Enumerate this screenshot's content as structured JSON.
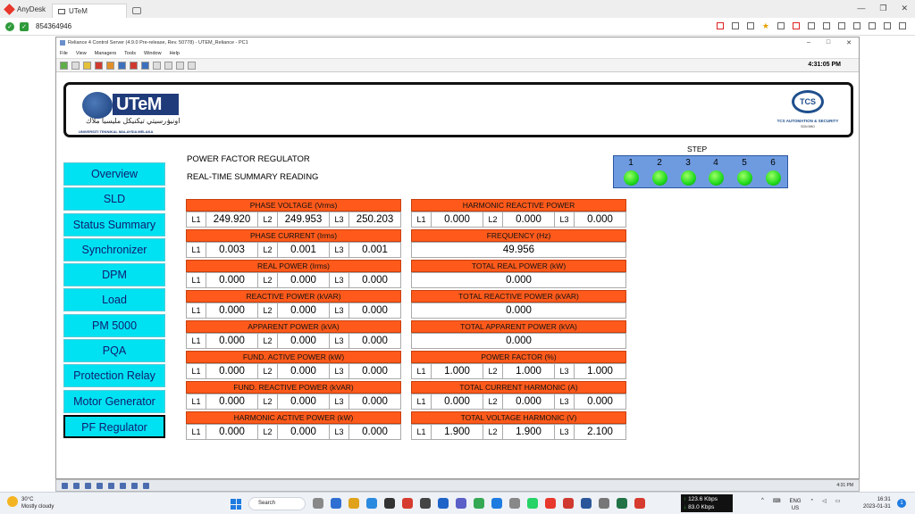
{
  "anydesk": {
    "brand": "AnyDesk",
    "tab_label": "UTeM",
    "remote_id": "854364946"
  },
  "window": {
    "title": "Reliance 4 Control Server (4.9.0 Pre-release, Rev. 50778) - UTEM_Reliance - PC1",
    "menu": [
      "File",
      "View",
      "Managers",
      "Tools",
      "Window",
      "Help"
    ],
    "clock": "4:31:05 PM"
  },
  "banner": {
    "utem_text": "UTeM",
    "utem_arabic": "اونيۏرسيتي تيكنيكل مليسيا ملاك",
    "utem_subtitle": "UNIVERSITI TEKNIKAL MALAYSIA MELAKA",
    "tcs_text": "TCS",
    "tcs_name": "TCS AUTOMATION & SECURITY",
    "tcs_sub": "SDN BHD"
  },
  "nav": [
    "Overview",
    "SLD",
    "Status Summary",
    "Synchronizer",
    "DPM",
    "Load",
    "PM 5000",
    "PQA",
    "Protection Relay",
    "Motor Generator",
    "PF Regulator"
  ],
  "page": {
    "title": "POWER FACTOR REGULATOR",
    "subtitle": "REAL-TIME SUMMARY READING"
  },
  "steps": {
    "label": "STEP",
    "numbers": [
      "1",
      "2",
      "3",
      "4",
      "5",
      "6"
    ],
    "led_color": "#1fd91c"
  },
  "colors": {
    "panel_header": "#ff5a1b",
    "nav_bg": "#00e2f2",
    "nav_text": "#101c6e",
    "step_box": "#6e9be0"
  },
  "left_panels": [
    {
      "title": "PHASE VOLTAGE (Vrms)",
      "labels": [
        "L1",
        "L2",
        "L3"
      ],
      "values": [
        "249.920",
        "249.953",
        "250.203"
      ]
    },
    {
      "title": "PHASE CURRENT (Irms)",
      "labels": [
        "L1",
        "L2",
        "L3"
      ],
      "values": [
        "0.003",
        "0.001",
        "0.001"
      ]
    },
    {
      "title": "REAL POWER (Irms)",
      "labels": [
        "L1",
        "L2",
        "L3"
      ],
      "values": [
        "0.000",
        "0.000",
        "0.000"
      ]
    },
    {
      "title": "REACTIVE POWER (kVAR)",
      "labels": [
        "L1",
        "L2",
        "L3"
      ],
      "values": [
        "0.000",
        "0.000",
        "0.000"
      ]
    },
    {
      "title": "APPARENT POWER (kVA)",
      "labels": [
        "L1",
        "L2",
        "L3"
      ],
      "values": [
        "0.000",
        "0.000",
        "0.000"
      ]
    },
    {
      "title": "FUND. ACTIVE POWER (kW)",
      "labels": [
        "L1",
        "L2",
        "L3"
      ],
      "values": [
        "0.000",
        "0.000",
        "0.000"
      ]
    },
    {
      "title": "FUND. REACTIVE POWER (kVAR)",
      "labels": [
        "L1",
        "L2",
        "L3"
      ],
      "values": [
        "0.000",
        "0.000",
        "0.000"
      ]
    },
    {
      "title": "HARMONIC ACTIVE POWER (kW)",
      "labels": [
        "L1",
        "L2",
        "L3"
      ],
      "values": [
        "0.000",
        "0.000",
        "0.000"
      ]
    }
  ],
  "right_panels": [
    {
      "title": "HARMONIC REACTIVE POWER",
      "labels": [
        "L1",
        "L2",
        "L3"
      ],
      "values": [
        "0.000",
        "0.000",
        "0.000"
      ]
    },
    {
      "title": "FREQUENCY (Hz)",
      "value": "49.956"
    },
    {
      "title": "TOTAL REAL POWER (kW)",
      "value": "0.000"
    },
    {
      "title": "TOTAL REACTIVE POWER (kVAR)",
      "value": "0.000"
    },
    {
      "title": "TOTAL APPARENT POWER (kVA)",
      "value": "0.000"
    },
    {
      "title": "POWER FACTOR (%)",
      "labels": [
        "L1",
        "L2",
        "L3"
      ],
      "values": [
        "1.000",
        "1.000",
        "1.000"
      ]
    },
    {
      "title": "TOTAL CURRENT HARMONIC (A)",
      "labels": [
        "L1",
        "L2",
        "L3"
      ],
      "values": [
        "0.000",
        "0.000",
        "0.000"
      ]
    },
    {
      "title": "TOTAL VOLTAGE HARMONIC (V)",
      "labels": [
        "L1",
        "L2",
        "L3"
      ],
      "values": [
        "1.900",
        "1.900",
        "2.100"
      ]
    }
  ],
  "remote_tray": {
    "time": "4:31 PM"
  },
  "taskbar": {
    "weather_temp": "30°C",
    "weather_desc": "Mostly cloudy",
    "search": "Search",
    "net_up": "123.6 Kbps",
    "net_down": "83.0 Kbps",
    "lang": "ENG",
    "region": "US",
    "time": "16:31",
    "date": "2023-01-31",
    "notifications": "1"
  }
}
